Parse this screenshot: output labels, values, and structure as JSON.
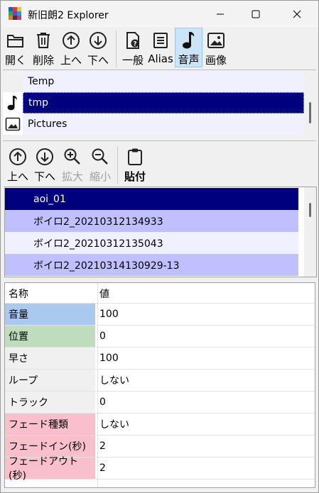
{
  "window": {
    "title": "新旧朗2 Explorer"
  },
  "toolbar_top": {
    "buttons": [
      {
        "label": "開く",
        "icon": "folder-icon"
      },
      {
        "label": "削除",
        "icon": "trash-icon"
      },
      {
        "label": "上へ",
        "icon": "arrow-up-circle-icon"
      },
      {
        "label": "下へ",
        "icon": "arrow-down-circle-icon"
      },
      {
        "label": "一般",
        "icon": "document-question-icon"
      },
      {
        "label": "Alias",
        "icon": "list-document-icon"
      },
      {
        "label": "音声",
        "icon": "music-note-icon",
        "active": true
      },
      {
        "label": "画像",
        "icon": "image-icon"
      }
    ]
  },
  "folder_list": {
    "items": [
      {
        "label": "Temp",
        "icon": "",
        "selected": false
      },
      {
        "label": "tmp",
        "icon": "music-note-icon",
        "selected": true
      },
      {
        "label": "Pictures",
        "icon": "image-icon",
        "selected": false
      }
    ]
  },
  "toolbar_mid": {
    "buttons": [
      {
        "label": "上へ",
        "icon": "arrow-up-circle-icon",
        "enabled": true
      },
      {
        "label": "下へ",
        "icon": "arrow-down-circle-icon",
        "enabled": true
      },
      {
        "label": "拡大",
        "icon": "zoom-in-icon",
        "enabled": false
      },
      {
        "label": "縮小",
        "icon": "zoom-out-icon",
        "enabled": false
      },
      {
        "label": "貼付",
        "icon": "clipboard-icon",
        "enabled": true
      }
    ]
  },
  "file_list": {
    "items": [
      {
        "label": "aoi_01",
        "state": "selected"
      },
      {
        "label": "ボイロ2_20210312134933",
        "state": "highlight"
      },
      {
        "label": "ボイロ2_20210312135043",
        "state": "normal"
      },
      {
        "label": "ボイロ2_20210314130929-13",
        "state": "highlight"
      }
    ]
  },
  "properties": {
    "header": {
      "name": "名称",
      "value": "値"
    },
    "rows": [
      {
        "name": "音量",
        "value": "100",
        "color": "#a9c9ef"
      },
      {
        "name": "位置",
        "value": "0",
        "color": "#bfdcbf"
      },
      {
        "name": "早さ",
        "value": "100",
        "color": "#f0f0f0"
      },
      {
        "name": "ループ",
        "value": "しない",
        "color": "#f0f0f0"
      },
      {
        "name": "トラック",
        "value": "0",
        "color": "#f0f0f0"
      },
      {
        "name": "フェード種類",
        "value": "しない",
        "color": "#f9c0cb"
      },
      {
        "name": "フェードイン(秒)",
        "value": "2",
        "color": "#f9c0cb"
      },
      {
        "name": "フェードアウト(秒)",
        "value": "2",
        "color": "#f9c0cb"
      }
    ]
  },
  "colors": {
    "selected_bg": "#00007f",
    "highlight_bg": "#c0c0ff",
    "light_bg": "#f0f0ff",
    "active_tool_bg": "#cce4f7"
  }
}
